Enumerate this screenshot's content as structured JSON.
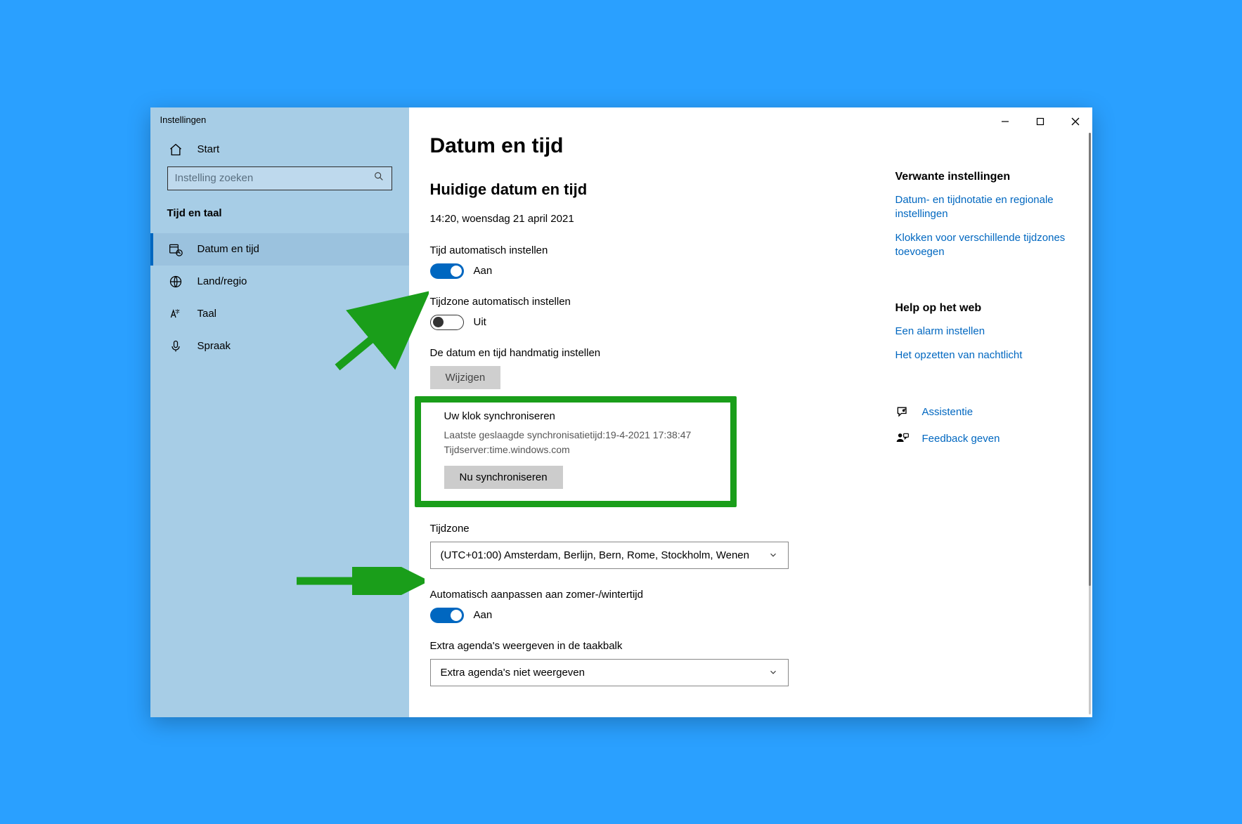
{
  "window": {
    "title": "Instellingen"
  },
  "sidebar": {
    "home": "Start",
    "search_placeholder": "Instelling zoeken",
    "category": "Tijd en taal",
    "items": [
      {
        "label": "Datum en tijd",
        "active": true
      },
      {
        "label": "Land/regio",
        "active": false
      },
      {
        "label": "Taal",
        "active": false
      },
      {
        "label": "Spraak",
        "active": false
      }
    ]
  },
  "main": {
    "heading": "Datum en tijd",
    "section1": {
      "title": "Huidige datum en tijd",
      "current_dt": "14:20, woensdag 21 april 2021"
    },
    "toggles": {
      "auto_time_label": "Tijd automatisch instellen",
      "auto_time_state": "Aan",
      "auto_tz_label": "Tijdzone automatisch instellen",
      "auto_tz_state": "Uit"
    },
    "manual": {
      "label": "De datum en tijd handmatig instellen",
      "button": "Wijzigen"
    },
    "sync": {
      "title": "Uw klok synchroniseren",
      "line1": "Laatste geslaagde synchronisatietijd:19-4-2021 17:38:47",
      "line2": "Tijdserver:time.windows.com",
      "button": "Nu synchroniseren"
    },
    "tz": {
      "label": "Tijdzone",
      "value": "(UTC+01:00) Amsterdam, Berlijn, Bern, Rome, Stockholm, Wenen"
    },
    "dst": {
      "label": "Automatisch aanpassen aan zomer-/wintertijd",
      "state": "Aan"
    },
    "extra_cal": {
      "label": "Extra agenda's weergeven in de taakbalk",
      "value": "Extra agenda's niet weergeven"
    }
  },
  "right": {
    "related_title": "Verwante instellingen",
    "related_links": [
      "Datum- en tijdnotatie en regionale instellingen",
      "Klokken voor verschillende tijdzones toevoegen"
    ],
    "help_title": "Help op het web",
    "help_links": [
      "Een alarm instellen",
      "Het opzetten van nachtlicht"
    ],
    "assist_link": "Assistentie",
    "feedback_link": "Feedback geven"
  }
}
